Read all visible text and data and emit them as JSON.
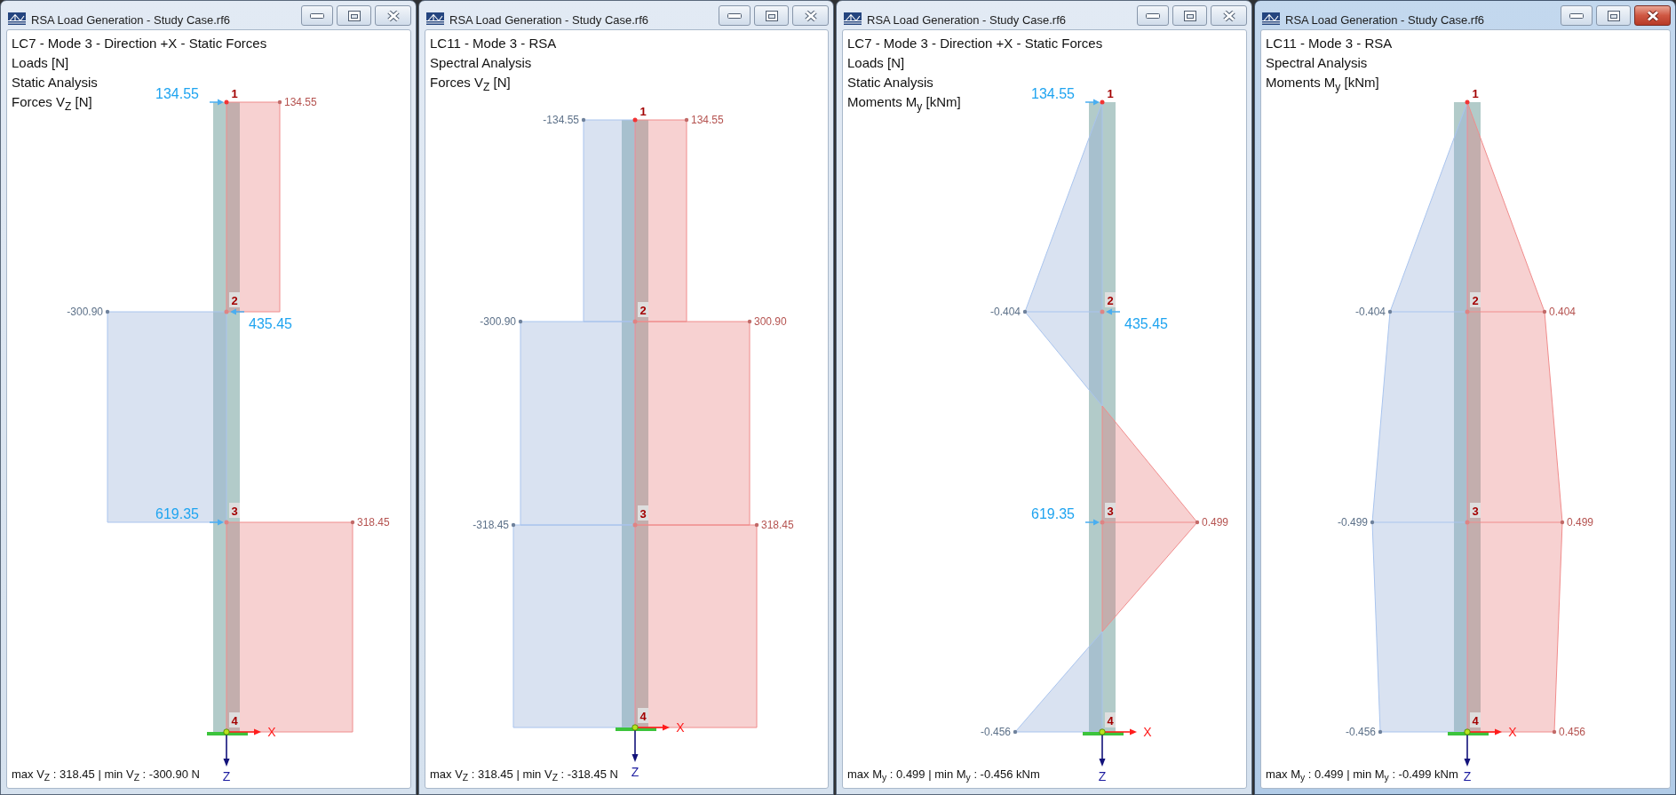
{
  "windows": [
    {
      "title": "RSA Load Generation - Study Case.rf6",
      "active": false,
      "header_lines": [
        "LC7 - Mode 3 - Direction +X - Static Forces",
        "Loads [N]",
        "Static Analysis",
        "Forces V$_{Z}$ [N]"
      ],
      "nodes": [
        "1",
        "2",
        "3",
        "4"
      ],
      "values": [
        {
          "text": "134.55",
          "kind": "positive"
        },
        {
          "text": "-300.90",
          "kind": "negative"
        },
        {
          "text": "318.45",
          "kind": "positive"
        }
      ],
      "loads": [
        {
          "text": "134.55",
          "kind": "right"
        },
        {
          "text": "435.45",
          "kind": "left"
        },
        {
          "text": "619.35",
          "kind": "right"
        }
      ],
      "axes": {
        "x": "X",
        "z": "Z"
      },
      "footer": "max V$_{Z}$ : 318.45 | min V$_{Z}$ : -300.90 N"
    },
    {
      "title": "RSA Load Generation - Study Case.rf6",
      "active": false,
      "header_lines": [
        "LC11 - Mode 3 - RSA",
        "Spectral Analysis",
        "Forces V$_{Z}$ [N]"
      ],
      "nodes": [
        "1",
        "2",
        "3",
        "4"
      ],
      "values": [
        {
          "text": "-134.55",
          "kind": "negative"
        },
        {
          "text": "134.55",
          "kind": "positive"
        },
        {
          "text": "-300.90",
          "kind": "negative"
        },
        {
          "text": "300.90",
          "kind": "positive"
        },
        {
          "text": "-318.45",
          "kind": "negative"
        },
        {
          "text": "318.45",
          "kind": "positive"
        }
      ],
      "axes": {
        "x": "X",
        "z": "Z"
      },
      "footer": "max V$_{Z}$ : 318.45 | min V$_{Z}$ : -318.45 N"
    },
    {
      "title": "RSA Load Generation - Study Case.rf6",
      "active": false,
      "header_lines": [
        "LC7 - Mode 3 - Direction +X - Static Forces",
        "Loads [N]",
        "Static Analysis",
        "Moments M$_{y}$ [kNm]"
      ],
      "nodes": [
        "1",
        "2",
        "3",
        "4"
      ],
      "values": [
        {
          "text": "-0.404",
          "kind": "negative"
        },
        {
          "text": "0.499",
          "kind": "positive"
        },
        {
          "text": "-0.456",
          "kind": "negative"
        }
      ],
      "loads": [
        {
          "text": "134.55",
          "kind": "right"
        },
        {
          "text": "435.45",
          "kind": "left"
        },
        {
          "text": "619.35",
          "kind": "right"
        }
      ],
      "axes": {
        "x": "X",
        "z": "Z"
      },
      "footer": "max M$_{y}$ : 0.499 | min M$_{y}$ : -0.456 kNm"
    },
    {
      "title": "RSA Load Generation - Study Case.rf6",
      "active": true,
      "header_lines": [
        "LC11 - Mode 3 - RSA",
        "Spectral Analysis",
        "Moments M$_{y}$ [kNm]"
      ],
      "nodes": [
        "1",
        "2",
        "3",
        "4"
      ],
      "values": [
        {
          "text": "-0.404",
          "kind": "negative"
        },
        {
          "text": "0.404",
          "kind": "positive"
        },
        {
          "text": "-0.499",
          "kind": "negative"
        },
        {
          "text": "0.499",
          "kind": "positive"
        },
        {
          "text": "-0.456",
          "kind": "negative"
        },
        {
          "text": "0.456",
          "kind": "positive"
        }
      ],
      "axes": {
        "x": "X",
        "z": "Z"
      },
      "footer": "max M$_{y}$ : 0.499 | min M$_{y}$ : -0.499 kNm"
    }
  ]
}
